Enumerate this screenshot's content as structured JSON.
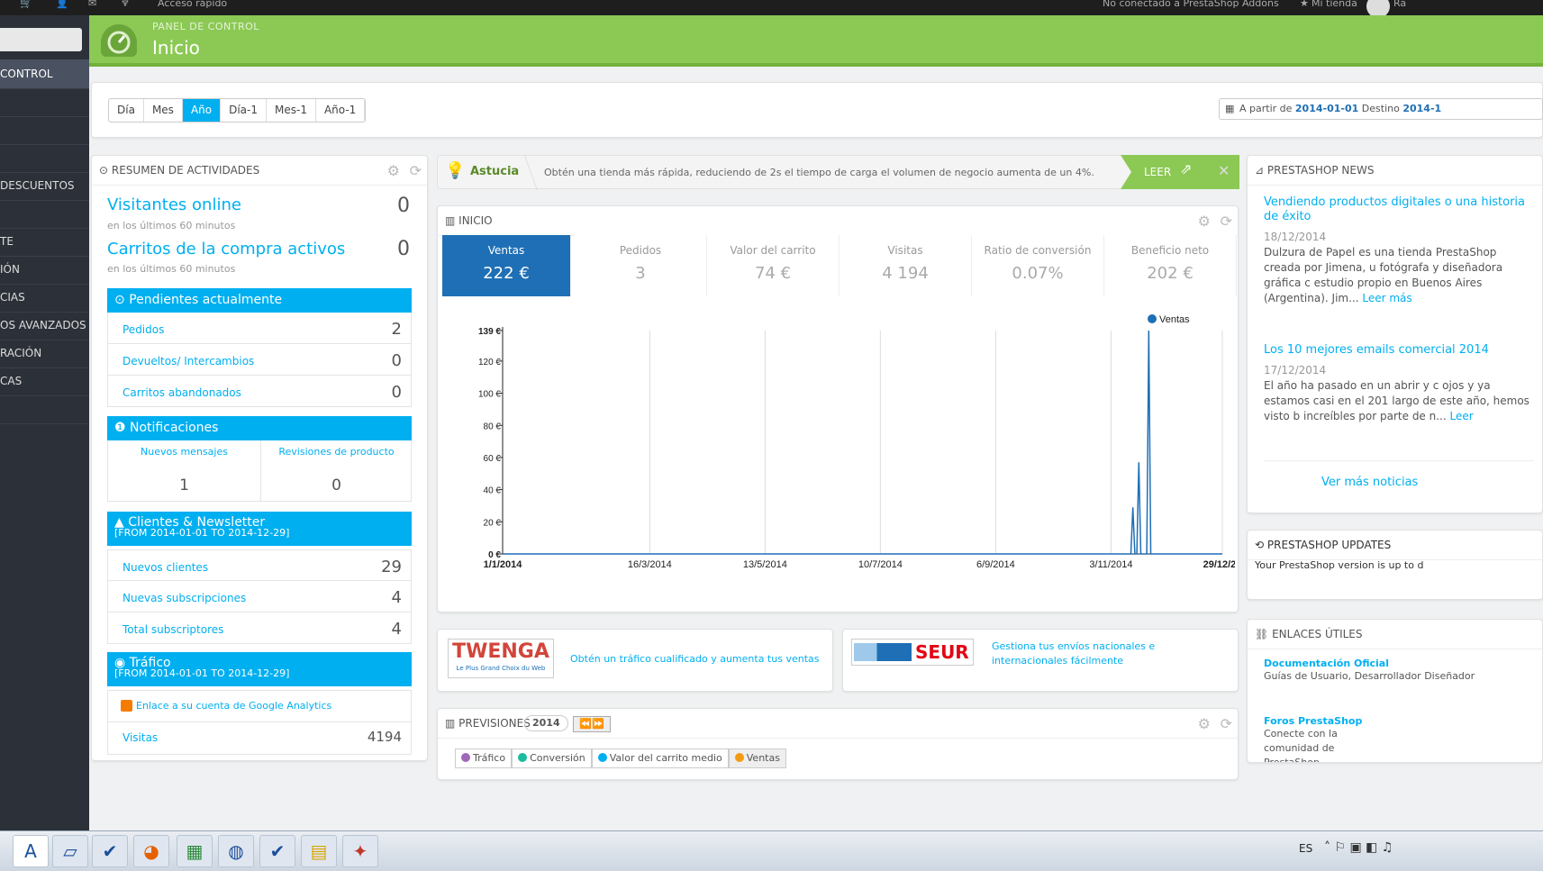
{
  "topbar": {
    "quick_access": "Acceso rápido",
    "addons_status": "No conectado a PrestaShop Addons",
    "shop": "Mi tienda",
    "user_initial": "Ra"
  },
  "sidebar": {
    "items": [
      "CONTROL",
      "",
      "",
      "",
      "DESCUENTOS",
      "",
      "TE",
      "IÓN",
      "CIAS",
      "OS AVANZADOS",
      "RACIÓN",
      "CAS",
      ""
    ]
  },
  "header": {
    "breadcrumb": "PANEL DE CONTROL",
    "title": "Inicio"
  },
  "period": {
    "tabs": [
      "Día",
      "Mes",
      "Año",
      "Día-1",
      "Mes-1",
      "Año-1"
    ],
    "active": "Año",
    "date_prefix": "A partir de",
    "date_from": "2014-01-01",
    "date_mid": "Destino",
    "date_to": "2014-1"
  },
  "activity": {
    "title": "RESUMEN DE ACTIVIDADES",
    "online_label": "Visitantes online",
    "online_sub": "en los últimos 60 minutos",
    "online_value": "0",
    "carts_label": "Carritos de la compra activos",
    "carts_sub": "en los últimos 60 minutos",
    "carts_value": "0",
    "pending_title": "Pendientes actualmente",
    "pending": [
      {
        "label": "Pedidos",
        "value": "2"
      },
      {
        "label": "Devueltos/ Intercambios",
        "value": "0"
      },
      {
        "label": "Carritos abandonados",
        "value": "0"
      }
    ],
    "notif_title": "Notificaciones",
    "notif_messages_label": "Nuevos mensajes",
    "notif_messages_value": "1",
    "notif_reviews_label": "Revisiones de producto",
    "notif_reviews_value": "0",
    "clients_title": "Clientes & Newsletter",
    "clients_range": "[FROM 2014-01-01 TO 2014-12-29]",
    "clients": [
      {
        "label": "Nuevos clientes",
        "value": "29"
      },
      {
        "label": "Nuevas subscripciones",
        "value": "4"
      },
      {
        "label": "Total subscriptores",
        "value": "4"
      }
    ],
    "traffic_title": "Tráfico",
    "traffic_range": "[FROM 2014-01-01 TO 2014-12-29]",
    "analytics_link": "Enlace a su cuenta de Google Analytics",
    "visits_label": "Visitas",
    "visits_value": "4194"
  },
  "tip": {
    "label": "Astucia",
    "text": "Obtén una tienda más rápida, reduciendo de 2s el tiempo de carga el volumen de negocio aumenta de un 4%.",
    "read": "LEER"
  },
  "dashgoals": {
    "title": "INICIO",
    "kpis": [
      {
        "label": "Ventas",
        "value": "222 €"
      },
      {
        "label": "Pedidos",
        "value": "3"
      },
      {
        "label": "Valor del carrito",
        "value": "74 €"
      },
      {
        "label": "Visitas",
        "value": "4 194"
      },
      {
        "label": "Ratio de conversión",
        "value": "0.07%"
      },
      {
        "label": "Beneficio neto",
        "value": "202 €"
      }
    ]
  },
  "chart_data": {
    "type": "line",
    "series": [
      {
        "name": "Ventas",
        "color": "#1e6fb6"
      }
    ],
    "ytick_labels": [
      "0 €",
      "20 €",
      "40 €",
      "60 €",
      "80 €",
      "100 €",
      "120 €",
      "139 €"
    ],
    "yticks": [
      0,
      20,
      40,
      60,
      80,
      100,
      120,
      139
    ],
    "xtick_labels": [
      "1/1/2014",
      "16/3/2014",
      "13/5/2014",
      "10/7/2014",
      "6/9/2014",
      "3/11/2014",
      "29/12/20"
    ],
    "xticks": [
      0,
      74,
      132,
      190,
      248,
      306,
      362
    ],
    "ylim": [
      0,
      139
    ],
    "xlim": [
      0,
      362
    ],
    "points": [
      [
        0,
        0
      ],
      [
        316,
        0
      ],
      [
        317,
        29
      ],
      [
        318,
        0
      ],
      [
        319,
        0
      ],
      [
        320,
        57
      ],
      [
        321,
        0
      ],
      [
        324,
        0
      ],
      [
        325,
        139
      ],
      [
        326,
        0
      ],
      [
        362,
        0
      ]
    ],
    "legend_position": "top-right",
    "grid": true
  },
  "partners": {
    "twenga_logo": "TWENGA",
    "twenga_sub": "Le Plus Grand Choix du Web",
    "twenga_text": "Obtén un tráfico cualificado y aumenta tus ventas",
    "seur_logo": "SEUR",
    "seur_text": "Gestiona tus envíos nacionales e internacionales fácilmente"
  },
  "forecast": {
    "title": "PREVISIONES",
    "year": "2014",
    "tabs": [
      "Tráfico",
      "Conversión",
      "Valor del carrito medio",
      "Ventas"
    ],
    "tab_colors": [
      "#a068b8",
      "#1abc9c",
      "#00aff0",
      "#f39c12"
    ]
  },
  "news": {
    "title": "PRESTASHOP NEWS",
    "items": [
      {
        "title": "Vendiendo productos digitales o una historia de éxito",
        "date": "18/12/2014",
        "text": "Dulzura de Papel es una tienda PrestaShop creada por Jimena, u fotógrafa y diseñadora gráfica c estudio propio en Buenos Aires (Argentina). Jim...",
        "more": "Leer más"
      },
      {
        "title": "Los 10 mejores emails comercial 2014",
        "date": "17/12/2014",
        "text": "El año ha pasado en un abrir y c ojos y ya estamos casi en el 201 largo de este año, hemos visto b increíbles por parte de n...",
        "more": "Leer"
      }
    ],
    "more_news": "Ver más noticias"
  },
  "updates": {
    "title": "PRESTASHOP UPDATES",
    "text": "Your PrestaShop version is up to d"
  },
  "links": {
    "title": "ENLACES ÚTILES",
    "items": [
      {
        "title": "Documentación Oficial",
        "text": "Guías de Usuario, Desarrollador Diseñador"
      },
      {
        "title": "Foros PrestaShop",
        "text": "Conecte con la comunidad de PrestaShop"
      }
    ]
  },
  "taskbar": {
    "lang": "ES"
  }
}
